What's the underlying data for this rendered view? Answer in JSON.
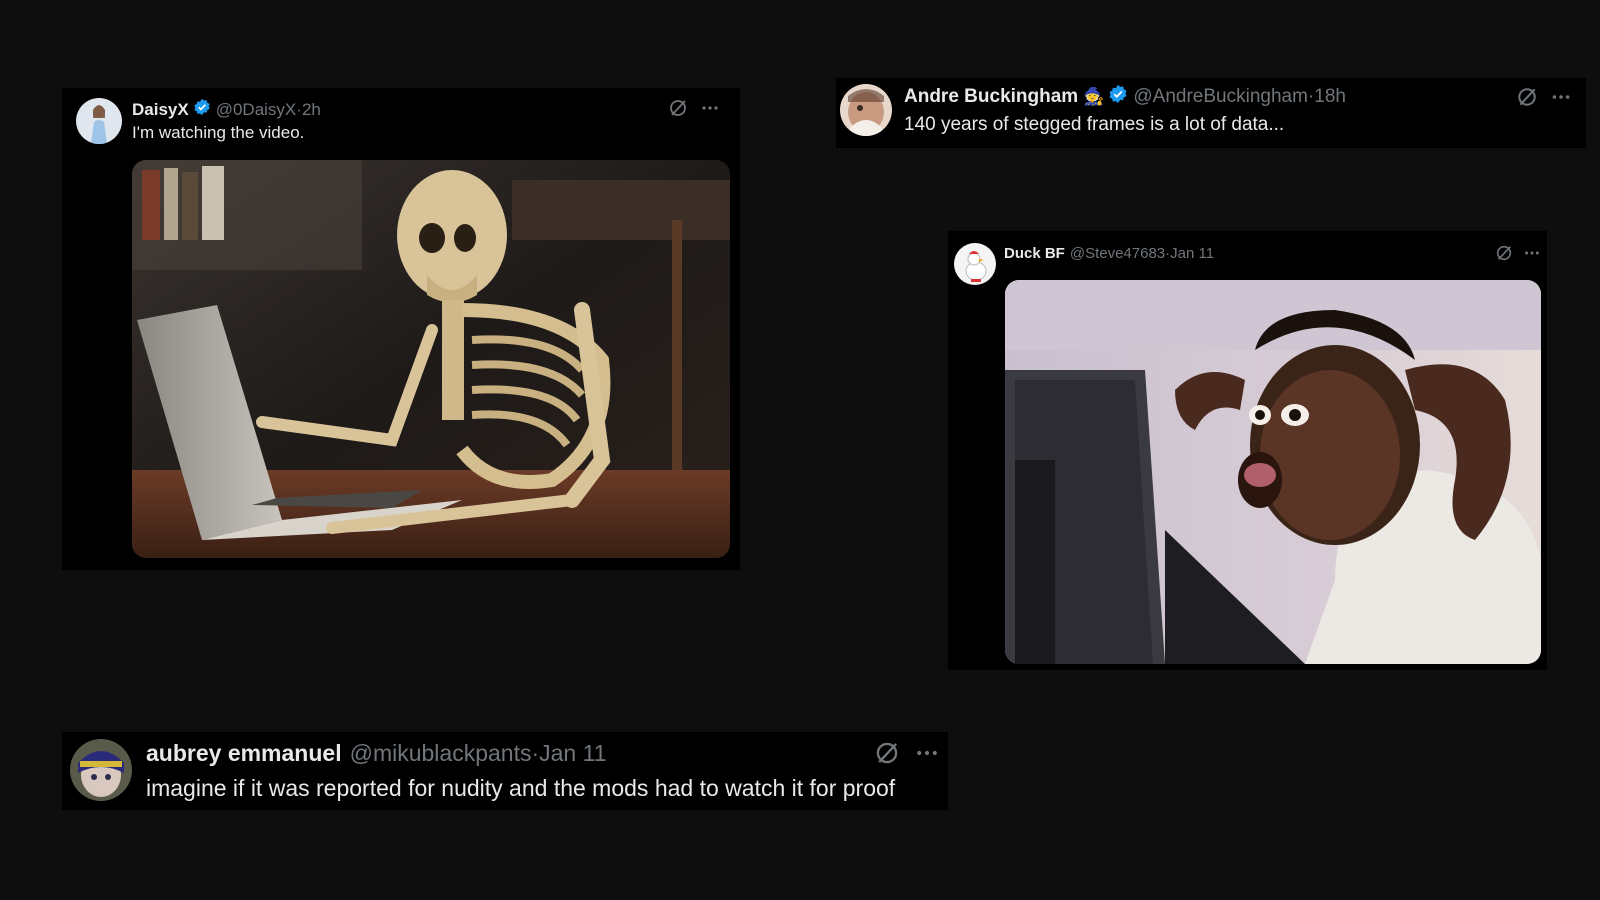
{
  "tweets": [
    {
      "display_name": "DaisyX",
      "handle": "@0DaisyX",
      "separator": " · ",
      "time": "2h",
      "text": "I'm watching the video.",
      "media": "skeleton-at-laptop-photo"
    },
    {
      "display_name": "Andre Buckingham",
      "name_emoji": "🧙",
      "handle": "@AndreBuckingham",
      "separator": " · ",
      "time": "18h",
      "text": "140 years of stegged frames is a lot of data..."
    },
    {
      "display_name": "Duck BF",
      "handle": "@Steve47683",
      "separator": " · ",
      "time": "Jan 11",
      "media": "shocked-man-at-computer-photo"
    },
    {
      "display_name": "aubrey emmanuel",
      "handle": "@mikublackpants",
      "separator": " · ",
      "time": "Jan 11",
      "text": "imagine if it was reported for nudity and the mods had to watch it for proof"
    }
  ],
  "icons": {
    "verified": "verified-badge-icon",
    "grok": "grok-icon",
    "more": "more-options-icon"
  },
  "colors": {
    "background": "#0e0e0e",
    "card": "#000000",
    "text": "#e7e9ea",
    "secondary": "#71767b",
    "verified": "#1d9bf0"
  }
}
